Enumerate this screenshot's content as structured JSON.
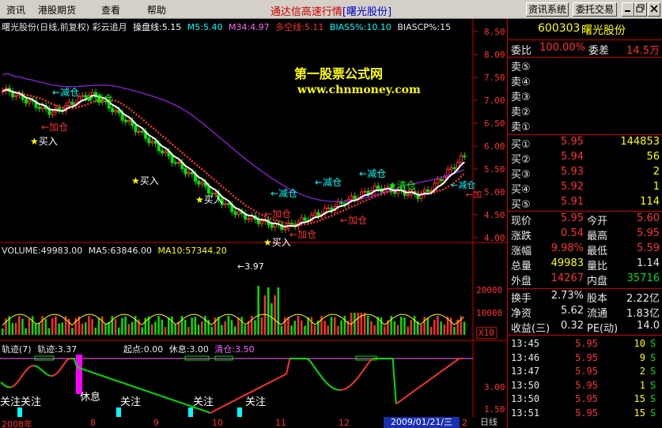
{
  "menu": {
    "items": [
      "资讯",
      "港股期货",
      "查看",
      "帮助"
    ],
    "title_left": "通达信高速行情",
    "title_right": "[曙光股份]",
    "btn_news": "资讯系统",
    "btn_trade": "委托交易"
  },
  "chart_header": {
    "main": "曙光股份(日线,前复权) 彩云追月",
    "p1": "操盘线:5.15",
    "p2": "M5:5.40",
    "p3": "M34:4.97",
    "p4": "多空线:5.11",
    "p5": "BIAS5%:10.10",
    "p6": "BIASCP%:15"
  },
  "watermark": {
    "line1": "第一股票公式网",
    "line2": "www.chnmoney.com"
  },
  "annotations": {
    "reduce1": "减仓",
    "clear1": "清仓",
    "add1": "加仓",
    "buy1": "买入",
    "buy2": "买入",
    "buy3": "买入",
    "low": "3.97",
    "buy4": "买入",
    "add2": "加仓",
    "add3": "加仓",
    "add4": "加仓",
    "reduce2": "减仓",
    "reduce3": "减仓",
    "reduce4": "减仓",
    "clear2": "清仓",
    "reduce5": "减仓",
    "add5": "加"
  },
  "price_axis": [
    "8.50",
    "8.00",
    "7.50",
    "7.00",
    "6.50",
    "6.00",
    "5.50",
    "5.00",
    "4.50",
    "4.00"
  ],
  "volume_header": {
    "vol": "VOLUME:49983.00",
    "ma5": "MA5:63846.00",
    "ma10": "MA10:57344.20"
  },
  "volume_axis": [
    "20000",
    "10000",
    "X10"
  ],
  "track_header": {
    "title": "轨迹(7)",
    "t1": "轨迹:3.37",
    "t2": "起点:0.00",
    "t3": "休息:3.00",
    "t4": "清仓:3.50"
  },
  "track_axis": [
    "3.00",
    "1.50"
  ],
  "track_labels": [
    "关注",
    "关注",
    "休息",
    "关注",
    "关注",
    "关注"
  ],
  "date_axis": [
    "2008年",
    "8",
    "9",
    "10",
    "11",
    "12"
  ],
  "date_box": "2009/01/21/三",
  "date_last": "2",
  "period": "日线",
  "stock": {
    "code": "600303",
    "name": "曙光股份",
    "weibi_label": "委比",
    "weibi": "100.00%",
    "weicha_label": "委差",
    "weicha": "14.5万"
  },
  "sells": [
    "卖⑤",
    "卖④",
    "卖③",
    "卖②",
    "卖①"
  ],
  "buys": [
    {
      "label": "买①",
      "price": "5.95",
      "vol": "144853"
    },
    {
      "label": "买②",
      "price": "5.94",
      "vol": "56"
    },
    {
      "label": "买③",
      "price": "5.93",
      "vol": "2"
    },
    {
      "label": "买④",
      "price": "5.92",
      "vol": "1"
    },
    {
      "label": "买⑤",
      "price": "5.91",
      "vol": "114"
    }
  ],
  "quote": [
    {
      "l1": "现价",
      "v1": "5.95",
      "l2": "今开",
      "v2": "5.60"
    },
    {
      "l1": "涨跌",
      "v1": "0.54",
      "l2": "最高",
      "v2": "5.95"
    },
    {
      "l1": "涨幅",
      "v1": "9.98%",
      "l2": "最低",
      "v2": "5.59"
    },
    {
      "l1": "总量",
      "v1": "49983",
      "l2": "量比",
      "v2": "1.14"
    },
    {
      "l1": "外盘",
      "v1": "14267",
      "l2": "内盘",
      "v2": "35716"
    }
  ],
  "fund": [
    {
      "l1": "换手",
      "v1": "2.73%",
      "l2": "股本",
      "v2": "2.22亿"
    },
    {
      "l1": "净资",
      "v1": "5.62",
      "l2": "流通",
      "v2": "1.83亿"
    },
    {
      "l1": "收益(三)",
      "v1": "0.32",
      "l2": "PE(动)",
      "v2": "14.0"
    }
  ],
  "ticks": [
    {
      "time": "13:45",
      "price": "5.95",
      "vol": "10",
      "dir": "S"
    },
    {
      "time": "13:46",
      "price": "5.95",
      "vol": "9",
      "dir": "S"
    },
    {
      "time": "13:47",
      "price": "5.95",
      "vol": "2",
      "dir": "S"
    },
    {
      "time": "13:50",
      "price": "5.95",
      "vol": "1",
      "dir": "S"
    },
    {
      "time": "13:50",
      "price": "5.95",
      "vol": "15",
      "dir": "S"
    },
    {
      "time": "13:51",
      "price": "5.95",
      "vol": "15",
      "dir": "S"
    }
  ],
  "colors": {
    "up": "#ff3030",
    "down": "#00e000",
    "yellow": "#ffff00",
    "cyan": "#00ffff",
    "magenta": "#ff00ff",
    "axis_red": "#cc0000"
  }
}
